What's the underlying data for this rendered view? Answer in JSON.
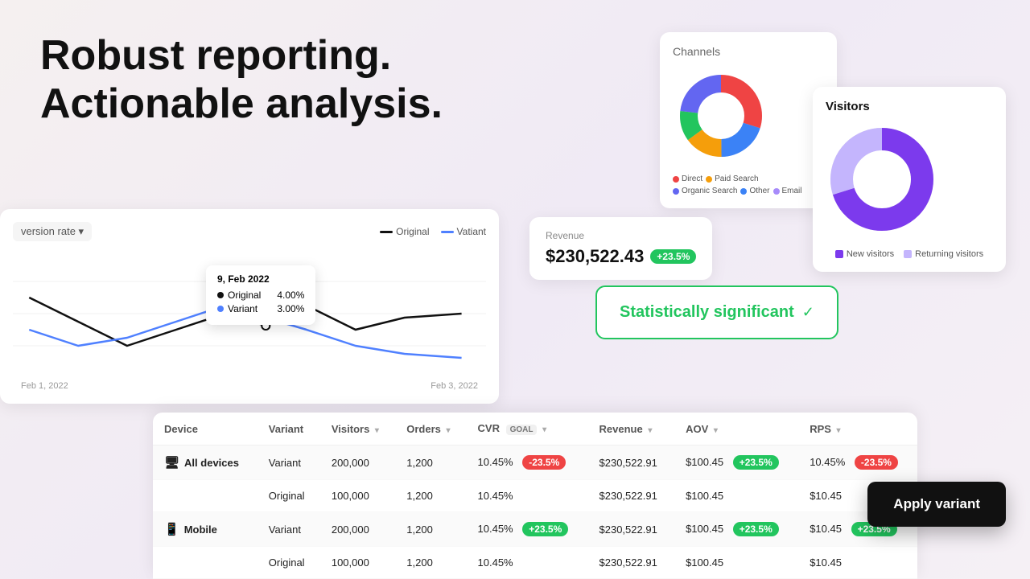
{
  "hero": {
    "line1": "Robust reporting.",
    "line2": "Actionable analysis."
  },
  "channels_card": {
    "title": "Channels",
    "legend": [
      {
        "label": "Direct",
        "color": "#ef4444"
      },
      {
        "label": "Paid Search",
        "color": "#eab308"
      },
      {
        "label": "Organic Search",
        "color": "#6366f1"
      },
      {
        "label": "Other",
        "color": "#3b82f6"
      },
      {
        "label": "Email",
        "color": "#a78bfa"
      }
    ]
  },
  "visitors_card": {
    "title": "Visitors",
    "legend": [
      {
        "label": "New visitors",
        "color": "#7c3aed"
      },
      {
        "label": "Returning visitors",
        "color": "#c4b5fd"
      }
    ]
  },
  "revenue_card": {
    "label": "Revenue",
    "value": "$230,522.43",
    "badge": "+23.5%",
    "badge_type": "green"
  },
  "stat_sig": {
    "text": "Statistically significant",
    "icon": "✓"
  },
  "chart": {
    "selector_label": "version rate ▾",
    "legend": [
      {
        "label": "Original",
        "color": "#111"
      },
      {
        "label": "Vatiant",
        "color": "#4f80ff"
      }
    ],
    "tooltip": {
      "date": "9, Feb 2022",
      "rows": [
        {
          "label": "Original",
          "value": "4.00%",
          "dot": "black"
        },
        {
          "label": "Variant",
          "value": "3.00%",
          "dot": "blue"
        }
      ]
    },
    "dates": [
      "Feb 1, 2022",
      "Feb 3, 2022"
    ]
  },
  "table": {
    "headers": [
      "Device",
      "Variant",
      "Visitors",
      "Orders",
      "CVR",
      "Revenue",
      "AOV",
      "RPS"
    ],
    "cvr_goal_label": "GOAL",
    "rows": [
      {
        "device": "All devices",
        "device_icon": "🖥",
        "variant": "Variant",
        "visitors": "200,000",
        "orders": "1,200",
        "cvr": "10.45%",
        "cvr_badge": "-23.5%",
        "cvr_badge_type": "red",
        "revenue": "$230,522.91",
        "aov": "$100.45",
        "aov_badge": "+23.5%",
        "aov_badge_type": "green",
        "rps": "10.45%",
        "rps_badge": "-23.5%",
        "rps_badge_type": "red",
        "is_primary": true
      },
      {
        "device": "",
        "variant": "Original",
        "visitors": "100,000",
        "orders": "1,200",
        "cvr": "10.45%",
        "cvr_badge": "",
        "revenue": "$230,522.91",
        "aov": "$100.45",
        "aov_badge": "",
        "rps": "$10.45",
        "rps_badge": "",
        "is_primary": false
      },
      {
        "device": "Mobile",
        "device_icon": "📱",
        "variant": "Variant",
        "visitors": "200,000",
        "orders": "1,200",
        "cvr": "10.45%",
        "cvr_badge": "+23.5%",
        "cvr_badge_type": "green",
        "revenue": "$230,522.91",
        "aov": "$100.45",
        "aov_badge": "+23.5%",
        "aov_badge_type": "green",
        "rps": "$10.45",
        "rps_badge": "+23.5%",
        "rps_badge_type": "green",
        "is_primary": true
      },
      {
        "device": "",
        "variant": "Original",
        "visitors": "100,000",
        "orders": "1,200",
        "cvr": "10.45%",
        "cvr_badge": "",
        "revenue": "$230,522.91",
        "aov": "$100.45",
        "aov_badge": "",
        "rps": "$10.45",
        "rps_badge": "",
        "is_primary": false
      }
    ]
  },
  "apply_variant_button": {
    "label": "Apply variant"
  }
}
